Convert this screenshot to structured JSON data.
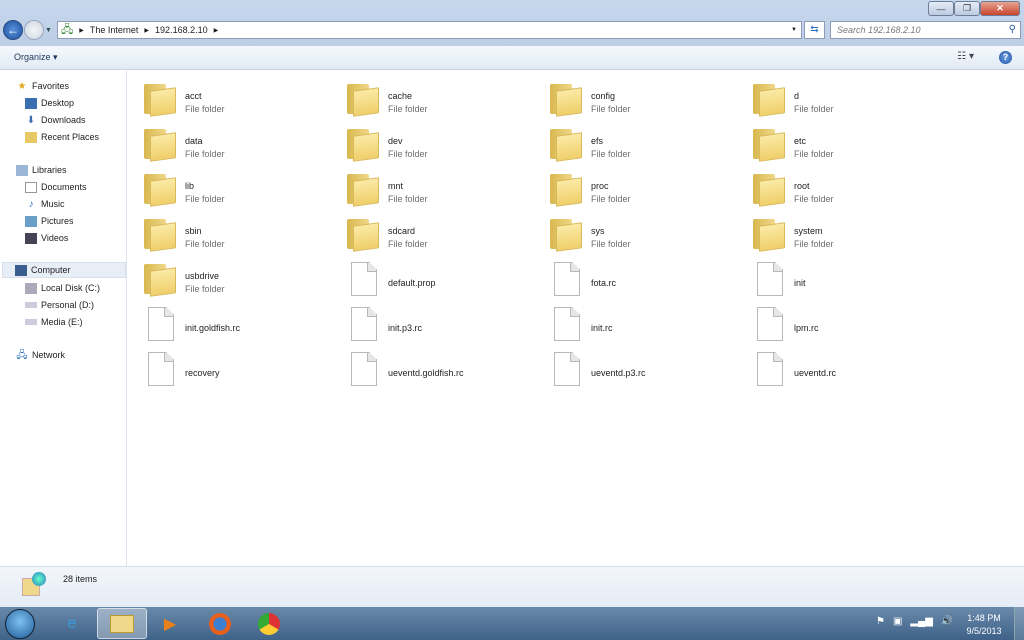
{
  "window": {
    "minimize": "—",
    "restore": "❐",
    "close": "✕"
  },
  "address": {
    "root": "The Internet",
    "host": "192.168.2.10"
  },
  "search": {
    "placeholder": "Search 192.168.2.10"
  },
  "toolbar": {
    "organize": "Organize ▾",
    "view": "☷ ▾",
    "help": "?"
  },
  "sidebar": {
    "favorites": {
      "label": "Favorites",
      "items": [
        "Desktop",
        "Downloads",
        "Recent Places"
      ]
    },
    "libraries": {
      "label": "Libraries",
      "items": [
        "Documents",
        "Music",
        "Pictures",
        "Videos"
      ]
    },
    "computer": {
      "label": "Computer",
      "items": [
        "Local Disk (C:)",
        "Personal (D:)",
        "Media (E:)"
      ]
    },
    "network": {
      "label": "Network"
    }
  },
  "folder_type": "File folder",
  "items": [
    {
      "name": "acct",
      "kind": "folder"
    },
    {
      "name": "cache",
      "kind": "folder"
    },
    {
      "name": "config",
      "kind": "folder"
    },
    {
      "name": "d",
      "kind": "folder"
    },
    {
      "name": "data",
      "kind": "folder"
    },
    {
      "name": "dev",
      "kind": "folder"
    },
    {
      "name": "efs",
      "kind": "folder"
    },
    {
      "name": "etc",
      "kind": "folder"
    },
    {
      "name": "lib",
      "kind": "folder"
    },
    {
      "name": "mnt",
      "kind": "folder"
    },
    {
      "name": "proc",
      "kind": "folder"
    },
    {
      "name": "root",
      "kind": "folder"
    },
    {
      "name": "sbin",
      "kind": "folder"
    },
    {
      "name": "sdcard",
      "kind": "folder"
    },
    {
      "name": "sys",
      "kind": "folder"
    },
    {
      "name": "system",
      "kind": "folder"
    },
    {
      "name": "usbdrive",
      "kind": "folder"
    },
    {
      "name": "default.prop",
      "kind": "file"
    },
    {
      "name": "fota.rc",
      "kind": "file"
    },
    {
      "name": "init",
      "kind": "file"
    },
    {
      "name": "init.goldfish.rc",
      "kind": "file"
    },
    {
      "name": "init.p3.rc",
      "kind": "file"
    },
    {
      "name": "init.rc",
      "kind": "file"
    },
    {
      "name": "lpm.rc",
      "kind": "file"
    },
    {
      "name": "recovery",
      "kind": "file"
    },
    {
      "name": "ueventd.goldfish.rc",
      "kind": "file"
    },
    {
      "name": "ueventd.p3.rc",
      "kind": "file"
    },
    {
      "name": "ueventd.rc",
      "kind": "file"
    }
  ],
  "status": {
    "count": "28 items"
  },
  "clock": {
    "time": "1:48 PM",
    "date": "9/5/2013"
  }
}
